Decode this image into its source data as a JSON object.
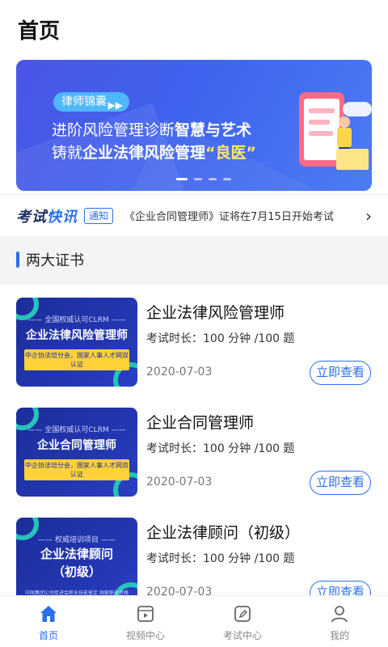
{
  "header": {
    "title": "首页"
  },
  "banner": {
    "tag": "律师锦囊",
    "line1_a": "进阶风险管理诊断",
    "line1_b": "智慧与艺术",
    "line2_a": "铸就",
    "line2_b": "企业法律风险管理",
    "line2_c": "“良医”"
  },
  "notice": {
    "brand_a": "考试",
    "brand_b": "快讯",
    "badge": "通知",
    "text": "《企业合同管理师》证将在7月15日开始考试"
  },
  "section": {
    "title": "两大证书"
  },
  "cards": [
    {
      "thumb_top": "—— 全国权威认可CLRM ——",
      "thumb_main": "企业法律风险管理师",
      "thumb_sub": "中企协法培分会，国家人事人才网双认证",
      "title": "企业法律风险管理师",
      "meta": "考试时长：100 分钟 /100 题",
      "date": "2020-07-03",
      "button": "立即查看"
    },
    {
      "thumb_top": "—— 全国权威认可CLRM ——",
      "thumb_main": "企业合同管理师",
      "thumb_sub": "中企协法培分会，国家人事人才网双认证",
      "title": "企业合同管理师",
      "meta": "考试时长：100 分钟 /100 题",
      "date": "2020-07-03",
      "button": "立即查看"
    },
    {
      "thumb_top": "—— 权威培训项目 ——",
      "thumb_main": "企业法律顾问",
      "thumb_main2": "（初级）",
      "thumb_sub": "中国集团公司促进会职业技能鉴定 国家职业资格培训鉴定",
      "title": "企业法律顾问（初级）",
      "meta": "考试时长：100 分钟 /100 题",
      "date": "2020-07-03",
      "button": "立即查看"
    }
  ],
  "tabs": [
    {
      "label": "首页",
      "icon": "home-icon",
      "active": true
    },
    {
      "label": "视频中心",
      "icon": "video-icon",
      "active": false
    },
    {
      "label": "考试中心",
      "icon": "exam-icon",
      "active": false
    },
    {
      "label": "我的",
      "icon": "user-icon",
      "active": false
    }
  ],
  "colors": {
    "accent": "#2a6ff0",
    "banner": "#4a5ce8",
    "thumb": "#1c2e9a"
  }
}
